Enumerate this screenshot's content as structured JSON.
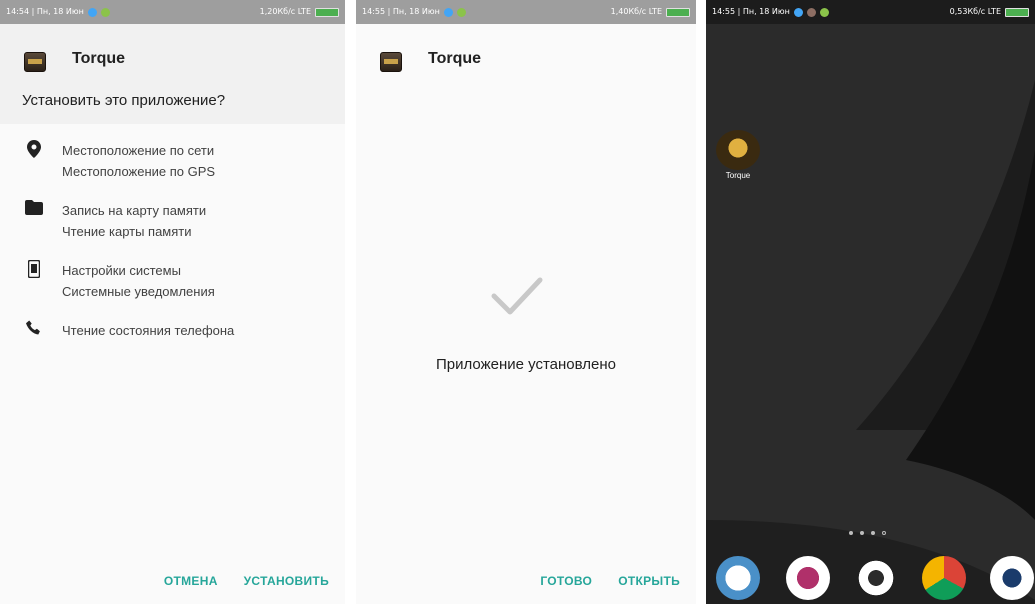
{
  "screen_install": {
    "status": {
      "left": "14:54 | Пн, 18 Июн",
      "right": "1,20Кб/с  LTE"
    },
    "app_title": "Torque",
    "question": "Установить это приложение?",
    "permissions": [
      {
        "icon": "location-pin-icon",
        "lines": [
          "Местоположение по сети",
          "Местоположение по GPS"
        ]
      },
      {
        "icon": "folder-icon",
        "lines": [
          "Запись на карту памяти",
          "Чтение карты памяти"
        ]
      },
      {
        "icon": "phone-settings-icon",
        "lines": [
          "Настройки системы",
          "Системные уведомления"
        ]
      },
      {
        "icon": "phone-call-icon",
        "lines": [
          "Чтение состояния телефона"
        ]
      }
    ],
    "cancel_label": "ОТМЕНА",
    "install_label": "УСТАНОВИТЬ"
  },
  "screen_done": {
    "status": {
      "left": "14:55 | Пн, 18 Июн",
      "right": "1,40Кб/с  LTE"
    },
    "app_title": "Torque",
    "message": "Приложение установлено",
    "done_label": "ГОТОВО",
    "open_label": "ОТКРЫТЬ"
  },
  "screen_home": {
    "status": {
      "left": "14:55 | Пн, 18 Июн",
      "right": "0,53Кб/с  LTE"
    },
    "desktop_app_label": "Torque",
    "pager": {
      "pages": 4,
      "active_index": 3
    },
    "dock_icons": [
      "phone-dialer-icon",
      "contacts-icon",
      "settings-gear-icon",
      "chrome-browser-icon",
      "camera-icon"
    ]
  },
  "colors": {
    "accent": "#26a69a",
    "status_bar": "#9e9e9e",
    "battery": "#4caf50",
    "wallpaper": "#2a2a2a"
  }
}
